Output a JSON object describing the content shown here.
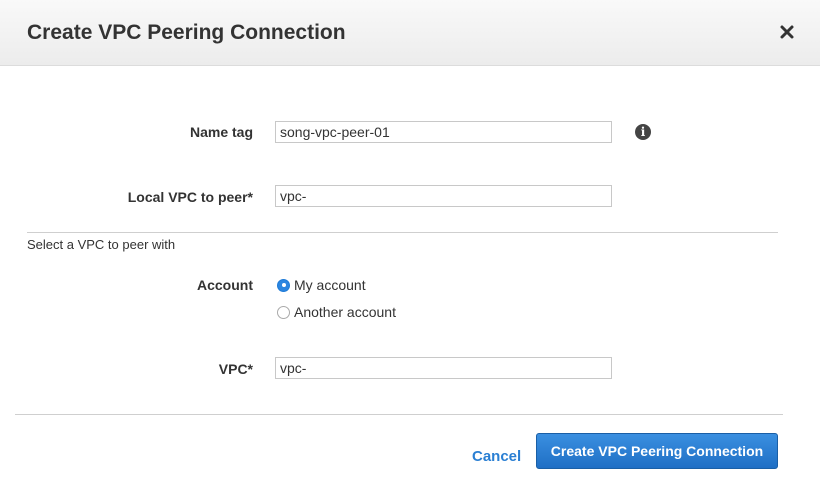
{
  "dialog": {
    "title": "Create VPC Peering Connection"
  },
  "form": {
    "name_tag": {
      "label": "Name tag",
      "value": "song-vpc-peer-01"
    },
    "local_vpc": {
      "label": "Local VPC to peer*",
      "value": "vpc-"
    },
    "peer_section_text": "Select a VPC to peer with",
    "account": {
      "label": "Account",
      "options": [
        {
          "label": "My account",
          "selected": true
        },
        {
          "label": "Another account",
          "selected": false
        }
      ]
    },
    "vpc": {
      "label": "VPC*",
      "value": "vpc-"
    }
  },
  "footer": {
    "cancel_label": "Cancel",
    "submit_label": "Create VPC Peering Connection"
  },
  "colors": {
    "accent": "#2b85e0",
    "link": "#2a7fd3",
    "primary_button": "#1f6fc5"
  },
  "icons": {
    "close": "close-icon",
    "info": "info-icon"
  }
}
